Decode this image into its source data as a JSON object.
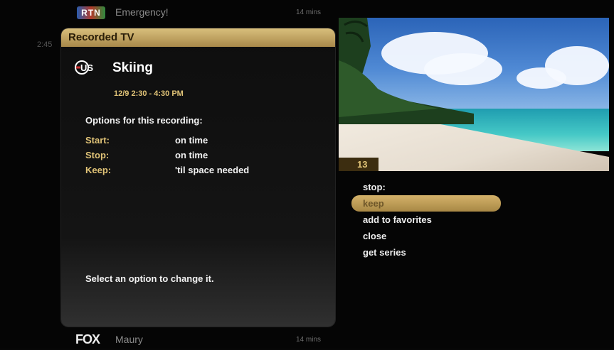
{
  "guide": {
    "top": {
      "network": "RTN",
      "title": "Emergency!",
      "duration": "14 mins"
    },
    "left_time": "2:45",
    "bottom": {
      "network": "FOX",
      "title": "Maury",
      "duration": "14 mins"
    }
  },
  "popup": {
    "header": "Recorded TV",
    "channel_logo": "US",
    "title": "Skiing",
    "time": "12/9 2:30 - 4:30 PM",
    "options_heading": "Options for this recording:",
    "options": [
      {
        "label": "Start:",
        "value": "on time"
      },
      {
        "label": "Stop:",
        "value": "on time"
      },
      {
        "label": "Keep:",
        "value": "'til space needed"
      }
    ],
    "hint": "Select an option to change it."
  },
  "preview": {
    "channel_number": "13"
  },
  "menu": {
    "items": [
      "stop:",
      "keep",
      "add to favorites",
      "close",
      "get series"
    ],
    "selected_index": 1
  },
  "colors": {
    "accent_gold": "#d9bf7c",
    "label_gold": "#e0c377",
    "background": "#070707"
  }
}
